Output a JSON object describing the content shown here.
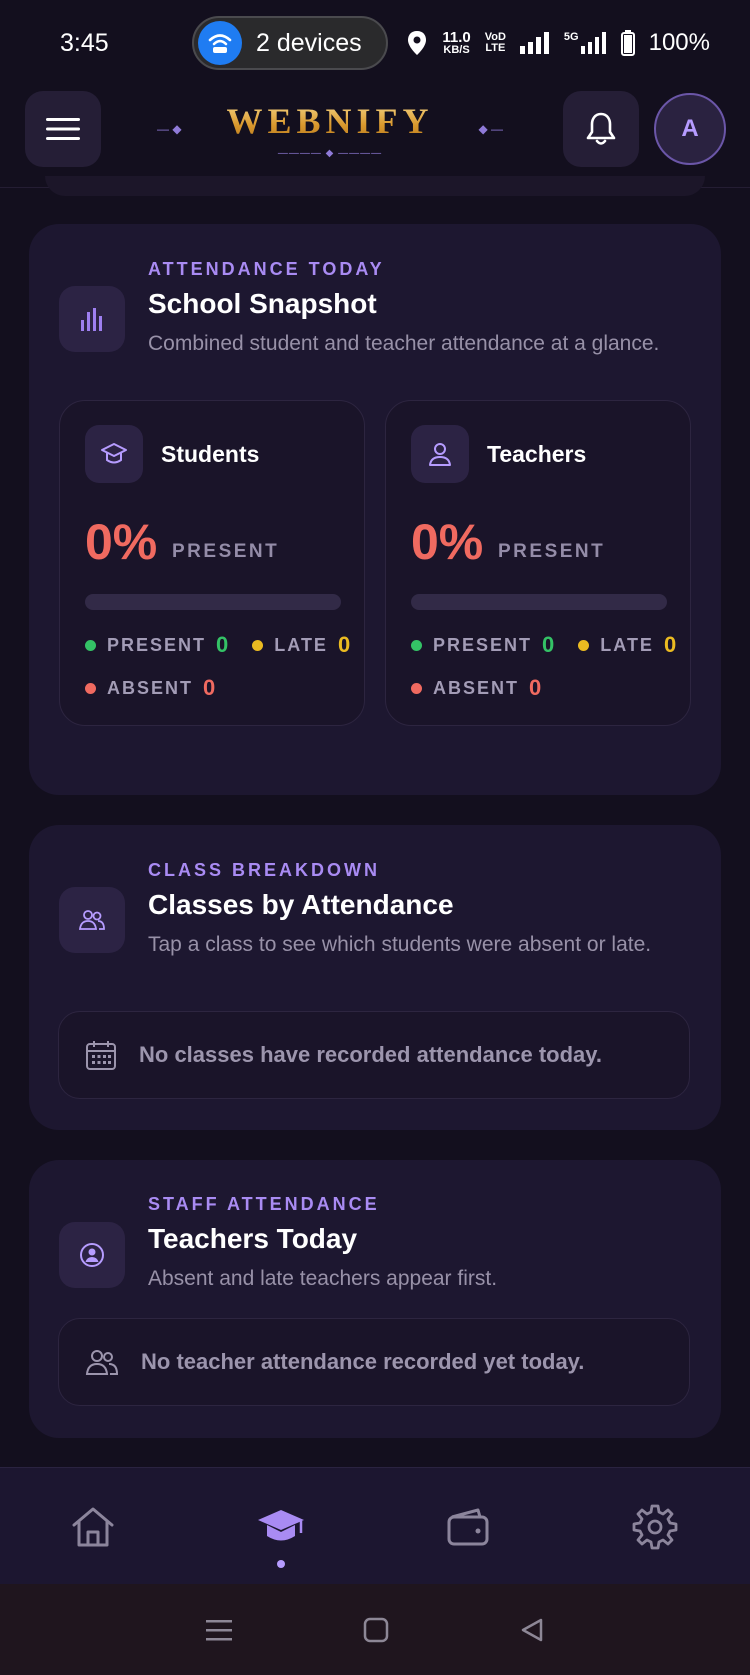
{
  "status_bar": {
    "time": "3:45",
    "hotspot_label": "2 devices",
    "net_speed_value": "11.0",
    "net_speed_unit": "KB/S",
    "volte_top": "VoD",
    "volte_bottom": "LTE",
    "five_g": "5G",
    "battery": "100%"
  },
  "header": {
    "brand": "WEBNIFY",
    "avatar_initial": "A",
    "icons": {
      "menu": "menu-icon",
      "bell": "bell-icon"
    }
  },
  "attendance_card": {
    "eyebrow": "ATTENDANCE TODAY",
    "title": "School Snapshot",
    "subtitle": "Combined student and teacher attendance at a glance.",
    "icon": "bar-chart-icon",
    "groups": [
      {
        "label": "Students",
        "icon": "graduation-cap-icon",
        "percent": "0%",
        "percent_fill": 0,
        "present_caption": "PRESENT",
        "present_label": "PRESENT",
        "present": "0",
        "late_label": "LATE",
        "late": "0",
        "absent_label": "ABSENT",
        "absent": "0"
      },
      {
        "label": "Teachers",
        "icon": "user-icon",
        "percent": "0%",
        "percent_fill": 0,
        "present_caption": "PRESENT",
        "present_label": "PRESENT",
        "present": "0",
        "late_label": "LATE",
        "late": "0",
        "absent_label": "ABSENT",
        "absent": "0"
      }
    ]
  },
  "classes_card": {
    "eyebrow": "CLASS BREAKDOWN",
    "title": "Classes by Attendance",
    "subtitle": "Tap a class to see which students were absent or late.",
    "icon": "users-icon",
    "empty_text": "No classes have recorded attendance today.",
    "empty_icon": "calendar-icon"
  },
  "staff_card": {
    "eyebrow": "STAFF ATTENDANCE",
    "title": "Teachers Today",
    "subtitle": "Absent and late teachers appear first.",
    "icon": "user-circle-icon",
    "empty_text": "No teacher attendance recorded yet today.",
    "empty_icon": "users-icon"
  },
  "bottom_nav": {
    "items": [
      "home-icon",
      "graduation-cap-icon",
      "wallet-icon",
      "gear-icon"
    ],
    "active": 1
  },
  "colors": {
    "accent": "#a98bf3",
    "present": "#34c266",
    "late": "#ebbb21",
    "absent": "#f06a60",
    "brand_gold": "#e0a93b"
  }
}
